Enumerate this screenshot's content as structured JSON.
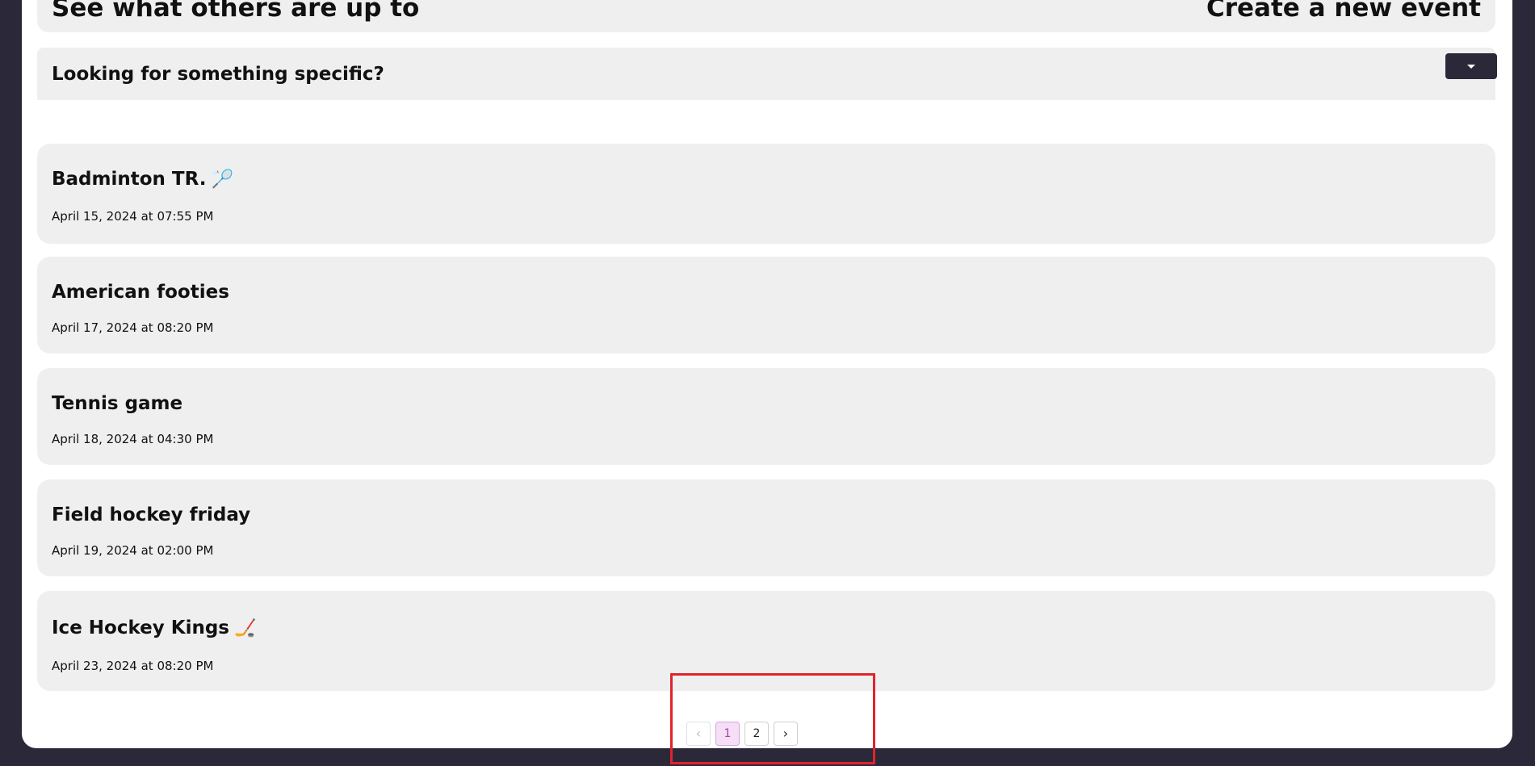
{
  "header": {
    "left_title": "See what others are up to",
    "right_title": "Create a new event"
  },
  "filter": {
    "label": "Looking for something specific?",
    "toggle_icon": "caret-down-icon"
  },
  "events": [
    {
      "title": "Badminton TR.",
      "emoji": "🏸",
      "date": "April 15, 2024 at 07:55 PM"
    },
    {
      "title": "American footies",
      "emoji": "",
      "date": "April 17, 2024 at 08:20 PM"
    },
    {
      "title": "Tennis game",
      "emoji": "",
      "date": "April 18, 2024 at 04:30 PM"
    },
    {
      "title": "Field hockey friday",
      "emoji": "",
      "date": "April 19, 2024 at 02:00 PM"
    },
    {
      "title": "Ice Hockey Kings",
      "emoji": "🏒",
      "date": "April 23, 2024 at 08:20 PM"
    }
  ],
  "pagination": {
    "prev_icon": "‹",
    "pages": [
      "1",
      "2"
    ],
    "current": "1",
    "next_icon": "›"
  },
  "colors": {
    "background": "#2b2839",
    "card": "#ffffff",
    "panel": "#efefef",
    "active_page": "#f6def6",
    "highlight": "#e0242b"
  }
}
